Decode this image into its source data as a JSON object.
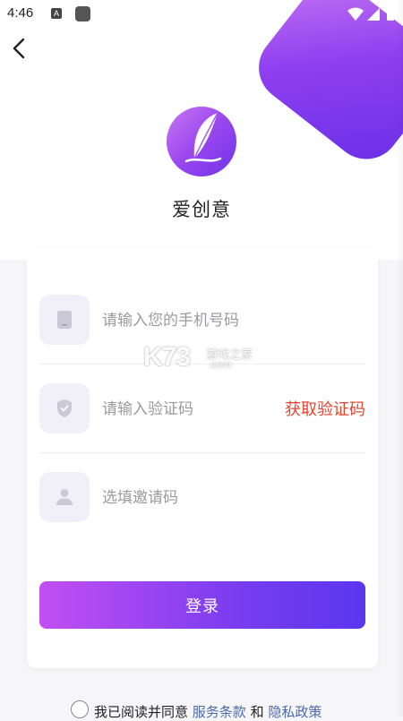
{
  "status_bar": {
    "time": "4:46",
    "notif_letter": "A"
  },
  "app": {
    "name": "爱创意",
    "colors": {
      "brand_purple": "#8f3ff0",
      "accent_red": "#e5442f",
      "link_blue": "#4c6ab0"
    }
  },
  "form": {
    "phone": {
      "placeholder": "请输入您的手机号码",
      "value": "",
      "icon": "phone-icon"
    },
    "code": {
      "placeholder": "请输入验证码",
      "value": "",
      "icon": "shield-check-icon",
      "get_code_label": "获取验证码"
    },
    "invite": {
      "placeholder": "选填邀请码",
      "value": "",
      "icon": "user-icon"
    },
    "login_label": "登录"
  },
  "watermark": {
    "big": "K73",
    "small1": "游戏之家",
    "small2": ".com"
  },
  "agreement": {
    "prefix": "我已阅读并同意",
    "terms_link": "服务条款",
    "joiner": "和",
    "privacy_link": "隐私政策",
    "checked": false
  }
}
